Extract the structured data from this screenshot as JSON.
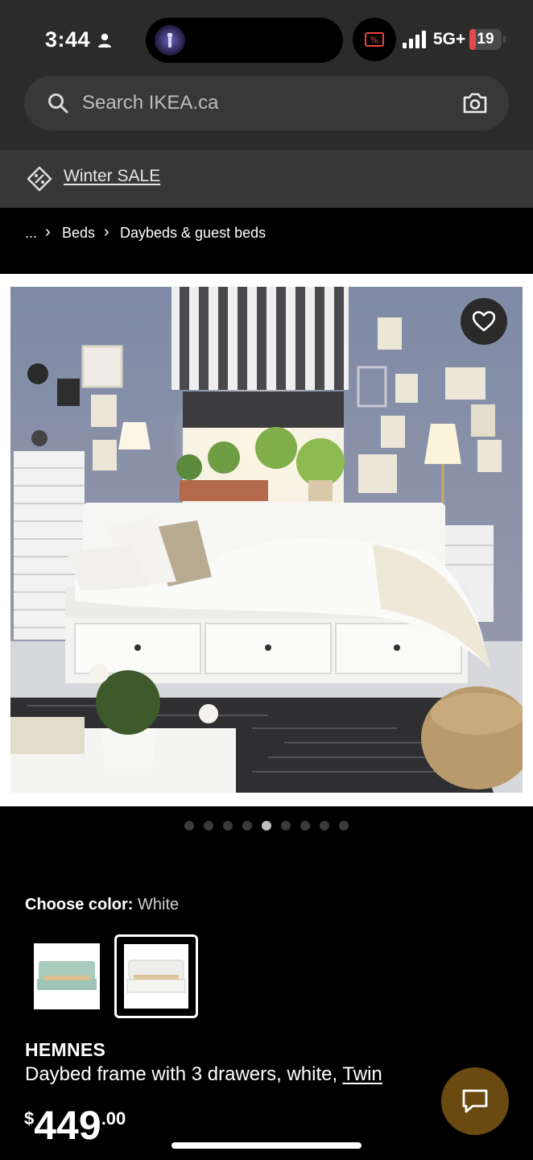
{
  "status_bar": {
    "time": "3:44",
    "network": "5G+",
    "battery_level": "19",
    "battery_fraction": 0.19,
    "icons": [
      "person-icon",
      "flashlight-icon",
      "recording-icon",
      "signal-icon",
      "battery-icon"
    ]
  },
  "search": {
    "placeholder": "Search IKEA.ca",
    "icon": "search-icon",
    "camera_icon": "camera-icon"
  },
  "promo": {
    "label": "Winter SALE",
    "icon": "tag-icon"
  },
  "breadcrumb": {
    "items": [
      "...",
      "Beds",
      "Daybeds & guest beds"
    ],
    "separator": "›"
  },
  "gallery": {
    "favorite_icon": "heart-icon",
    "total_images": 9,
    "active_index": 4
  },
  "color_picker": {
    "label": "Choose color:",
    "selected_value": "White",
    "options": [
      {
        "name": "green",
        "swatch": "#a9cbbd",
        "selected": false
      },
      {
        "name": "white",
        "swatch": "#f2f2f2",
        "selected": true
      }
    ]
  },
  "product": {
    "name": "HEMNES",
    "description": "Daybed frame with 3 drawers, white, ",
    "size_link": "Twin",
    "price_currency": "$",
    "price_whole": "449",
    "price_cents": ".00"
  },
  "chat": {
    "icon": "chat-icon"
  },
  "colors": {
    "header_bg": "#2b2b2b",
    "promo_bg": "#373737",
    "page_bg": "#000000",
    "chat_bg": "#6b4a12",
    "dot_active": "#bdbdbd",
    "dot_inactive": "#3a3a3a"
  }
}
